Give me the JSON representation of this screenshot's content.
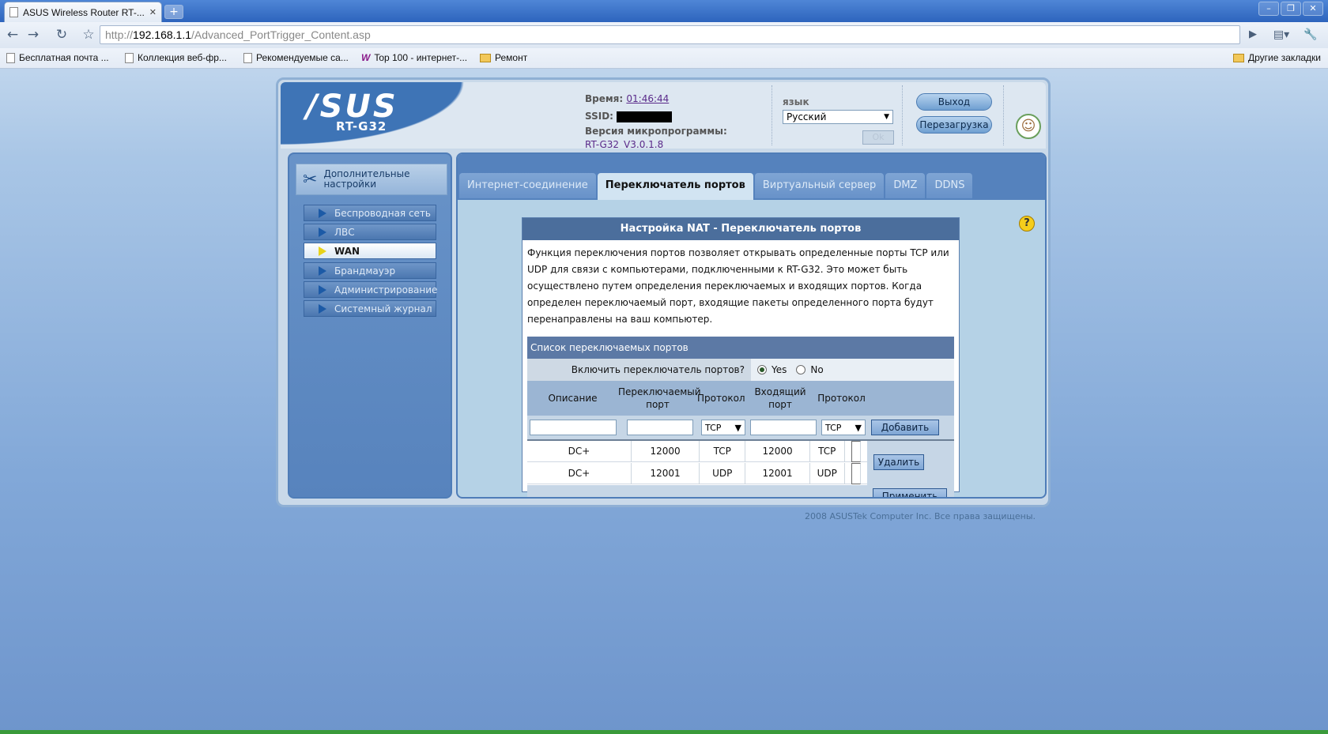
{
  "browser": {
    "tab_title": "ASUS Wireless Router RT-...",
    "url_scheme": "http://",
    "url_host": "192.168.1.1",
    "url_path": "/Advanced_PortTrigger_Content.asp",
    "bookmarks": [
      {
        "label": "Бесплатная почта ..."
      },
      {
        "label": "Коллекция веб-фр..."
      },
      {
        "label": "Рекомендуемые са..."
      },
      {
        "label": "Top 100 - интернет-..."
      },
      {
        "label": "Ремонт"
      }
    ],
    "other_bookmarks": "Другие закладки"
  },
  "header": {
    "logo": "/SUS",
    "model": "RT-G32",
    "time_label": "Время:",
    "time_value": "01:46:44",
    "ssid_label": "SSID:",
    "firmware_label": "Версия микропрограммы:",
    "firmware_value": "RT-G32_V3.0.1.8",
    "lang_label": "язык",
    "lang_value": "Русский",
    "ok_label": "Ok",
    "logout_label": "Выход",
    "reboot_label": "Перезагрузка"
  },
  "sidebar": {
    "title": "Дополнительные настройки",
    "items": [
      {
        "label": "Беспроводная сеть"
      },
      {
        "label": "ЛВС"
      },
      {
        "label": "WAN"
      },
      {
        "label": "Брандмауэр"
      },
      {
        "label": "Администрирование"
      },
      {
        "label": "Системный журнал"
      }
    ]
  },
  "tabs": [
    {
      "label": "Интернет-соединение"
    },
    {
      "label": "Переключатель портов"
    },
    {
      "label": "Виртуальный сервер"
    },
    {
      "label": "DMZ"
    },
    {
      "label": "DDNS"
    }
  ],
  "panel": {
    "title": "Настройка NAT - Переключатель портов",
    "description": "Функция переключения портов позволяет открывать определенные порты TCP или UDP для связи с компьютерами, подключенными к RT-G32. Это может быть осуществлено путем определения переключаемых и входящих портов. Когда определен переключаемый порт, входящие пакеты определенного порта будут перенаправлены на ваш компьютер.",
    "list_title": "Список переключаемых портов",
    "enable_label": "Включить переключатель портов?",
    "yes_label": "Yes",
    "no_label": "No",
    "columns": {
      "desc": "Описание",
      "trigger_port": "Переключаемый порт",
      "protocol1": "Протокол",
      "incoming_port": "Входящий порт",
      "protocol2": "Протокол"
    },
    "new_proto1": "TCP",
    "new_proto2": "TCP",
    "add_label": "Добавить",
    "delete_label": "Удалить",
    "apply_label": "Применить",
    "rows": [
      {
        "desc": "DC+",
        "trigger": "12000",
        "proto1": "TCP",
        "incoming": "12000",
        "proto2": "TCP"
      },
      {
        "desc": "DC+",
        "trigger": "12001",
        "proto1": "UDP",
        "incoming": "12001",
        "proto2": "UDP"
      }
    ]
  },
  "footer": "2008 ASUSTek Computer Inc. Все права защищены."
}
